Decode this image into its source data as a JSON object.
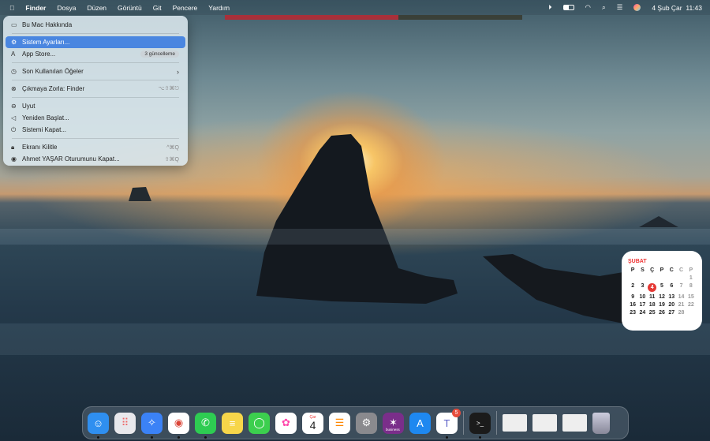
{
  "menubar": {
    "apple": "",
    "app": "Finder",
    "items": [
      "Dosya",
      "Düzen",
      "Görüntü",
      "Git",
      "Pencere",
      "Yardım"
    ],
    "date": "4 Şub Çar",
    "time": "11:43"
  },
  "apple_menu": {
    "about": "Bu Mac Hakkında",
    "settings": "Sistem Ayarları...",
    "appstore": "App Store...",
    "appstore_badge": "3 güncelleme",
    "recent": "Son Kullanılan Öğeler",
    "force_quit": "Çıkmaya Zorla: Finder",
    "force_quit_sc": "⌥⇧⌘⎋",
    "sleep": "Uyut",
    "restart": "Yeniden Başlat...",
    "shutdown": "Sistemi Kapat...",
    "lock": "Ekranı Kilitle",
    "lock_sc": "^⌘Q",
    "logout": "Ahmet YAŞAR Oturumunu Kapat...",
    "logout_sc": "⇧⌘Q"
  },
  "calendar": {
    "month": "ŞUBAT",
    "weekdays": [
      "P",
      "S",
      "Ç",
      "P",
      "C",
      "C",
      "P"
    ],
    "today": "4",
    "days": [
      "",
      "",
      "",
      "",
      "",
      "",
      "1",
      "2",
      "3",
      "4",
      "5",
      "6",
      "7",
      "8",
      "9",
      "10",
      "11",
      "12",
      "13",
      "14",
      "15",
      "16",
      "17",
      "18",
      "19",
      "20",
      "21",
      "22",
      "23",
      "24",
      "25",
      "26",
      "27",
      "28",
      ""
    ]
  },
  "dock": {
    "apps": [
      {
        "name": "finder",
        "color": "#2f8ff0",
        "running": true
      },
      {
        "name": "launchpad",
        "color": "#e8e8ec",
        "running": false
      },
      {
        "name": "safari",
        "color": "#3b82f6",
        "running": true
      },
      {
        "name": "chrome",
        "color": "#ffffff",
        "running": true
      },
      {
        "name": "whatsapp",
        "color": "#2ecc52",
        "running": true
      },
      {
        "name": "notes",
        "color": "#f7d64a",
        "running": false
      },
      {
        "name": "messages",
        "color": "#3ccf4e",
        "running": false
      },
      {
        "name": "photos",
        "color": "#ffffff",
        "running": false
      },
      {
        "name": "calendar",
        "color": "#ffffff",
        "running": false
      },
      {
        "name": "reminders",
        "color": "#ffffff",
        "running": false
      },
      {
        "name": "system-settings",
        "color": "#8a8a8e",
        "running": false
      },
      {
        "name": "splashtop-business",
        "color": "#7a2e8a",
        "running": false
      },
      {
        "name": "app-store",
        "color": "#1e88f0",
        "running": false
      },
      {
        "name": "teams",
        "color": "#ffffff",
        "running": true,
        "badge": "5"
      }
    ],
    "calendar_header": "Çar",
    "calendar_day": "4",
    "splashtop_label": "business",
    "terminal_glyph": ">_"
  }
}
